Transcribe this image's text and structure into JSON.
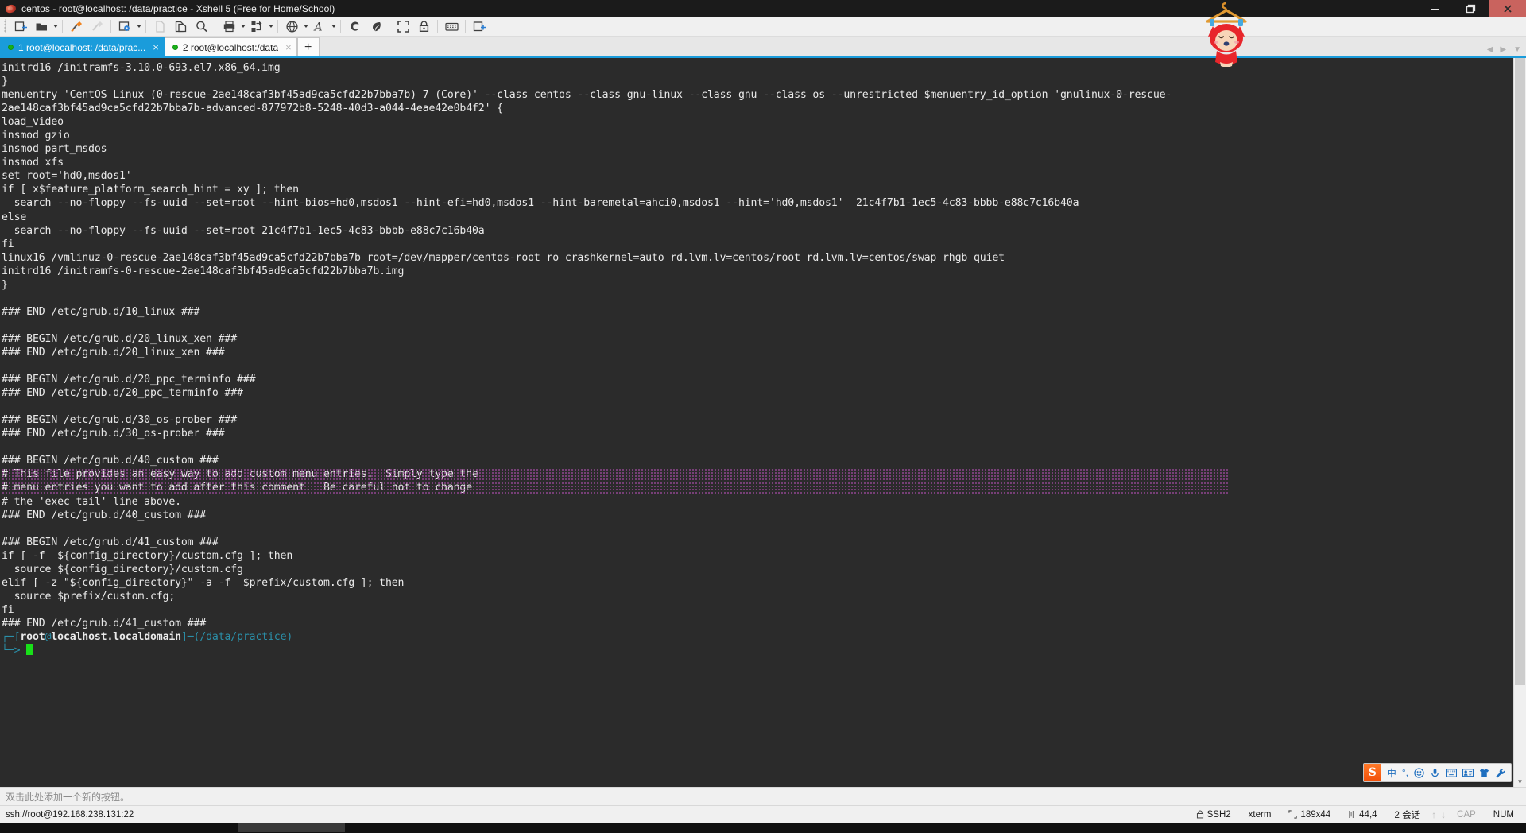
{
  "window": {
    "title": "centos - root@localhost: /data/practice - Xshell 5 (Free for Home/School)",
    "app_icon": "xshell-icon",
    "minimize": "minimize-button",
    "maximize": "maximize-button",
    "close": "close-button"
  },
  "toolbar": {
    "items": [
      {
        "name": "new-session-icon",
        "enabled": true,
        "caret": false
      },
      {
        "name": "open-session-icon",
        "enabled": true,
        "caret": true
      },
      {
        "name": "connect-icon",
        "enabled": true,
        "caret": false
      },
      {
        "name": "disconnect-icon",
        "enabled": false,
        "caret": false
      },
      {
        "name": "session-properties-icon",
        "enabled": true,
        "caret": true
      },
      {
        "name": "copy-icon",
        "enabled": false,
        "caret": false
      },
      {
        "name": "paste-icon",
        "enabled": true,
        "caret": false
      },
      {
        "name": "find-icon",
        "enabled": true,
        "caret": false
      },
      {
        "name": "print-icon",
        "enabled": true,
        "caret": true
      },
      {
        "name": "file-transfer-icon",
        "enabled": true,
        "caret": true
      },
      {
        "name": "globe-icon",
        "enabled": true,
        "caret": true
      },
      {
        "name": "font-icon",
        "enabled": true,
        "caret": true
      },
      {
        "name": "xshell-icon",
        "enabled": true,
        "caret": false
      },
      {
        "name": "xftp-icon",
        "enabled": true,
        "caret": false
      },
      {
        "name": "fullscreen-icon",
        "enabled": true,
        "caret": false
      },
      {
        "name": "lock-icon",
        "enabled": true,
        "caret": false
      },
      {
        "name": "keyboard-icon",
        "enabled": true,
        "caret": false
      },
      {
        "name": "add-button-icon",
        "enabled": true,
        "caret": false
      }
    ]
  },
  "tabs": {
    "items": [
      {
        "label": "1 root@localhost: /data/prac...",
        "active": true,
        "status_color": "#18b018",
        "close": "×"
      },
      {
        "label": "2 root@localhost:/data",
        "active": false,
        "status_color": "#18b018",
        "close": "×"
      }
    ],
    "new_tab_label": "+",
    "nav_prev": "◀",
    "nav_next": "▶",
    "nav_menu": "▼"
  },
  "terminal": {
    "lines": [
      {
        "text": "initrd16 /initramfs-3.10.0-693.el7.x86_64.img"
      },
      {
        "text": "}"
      },
      {
        "text": "menuentry 'CentOS Linux (0-rescue-2ae148caf3bf45ad9ca5cfd22b7bba7b) 7 (Core)' --class centos --class gnu-linux --class gnu --class os --unrestricted $menuentry_id_option 'gnulinux-0-rescue-"
      },
      {
        "text": "2ae148caf3bf45ad9ca5cfd22b7bba7b-advanced-877972b8-5248-40d3-a044-4eae42e0b4f2' {"
      },
      {
        "text": "load_video"
      },
      {
        "text": "insmod gzio"
      },
      {
        "text": "insmod part_msdos"
      },
      {
        "text": "insmod xfs"
      },
      {
        "text": "set root='hd0,msdos1'"
      },
      {
        "text": "if [ x$feature_platform_search_hint = xy ]; then"
      },
      {
        "text": "  search --no-floppy --fs-uuid --set=root --hint-bios=hd0,msdos1 --hint-efi=hd0,msdos1 --hint-baremetal=ahci0,msdos1 --hint='hd0,msdos1'  21c4f7b1-1ec5-4c83-bbbb-e88c7c16b40a"
      },
      {
        "text": "else"
      },
      {
        "text": "  search --no-floppy --fs-uuid --set=root 21c4f7b1-1ec5-4c83-bbbb-e88c7c16b40a"
      },
      {
        "text": "fi"
      },
      {
        "text": "linux16 /vmlinuz-0-rescue-2ae148caf3bf45ad9ca5cfd22b7bba7b root=/dev/mapper/centos-root ro crashkernel=auto rd.lvm.lv=centos/root rd.lvm.lv=centos/swap rhgb quiet"
      },
      {
        "text": "initrd16 /initramfs-0-rescue-2ae148caf3bf45ad9ca5cfd22b7bba7b.img"
      },
      {
        "text": "}"
      },
      {
        "text": ""
      },
      {
        "text": "### END /etc/grub.d/10_linux ###"
      },
      {
        "text": ""
      },
      {
        "text": "### BEGIN /etc/grub.d/20_linux_xen ###"
      },
      {
        "text": "### END /etc/grub.d/20_linux_xen ###"
      },
      {
        "text": ""
      },
      {
        "text": "### BEGIN /etc/grub.d/20_ppc_terminfo ###"
      },
      {
        "text": "### END /etc/grub.d/20_ppc_terminfo ###"
      },
      {
        "text": ""
      },
      {
        "text": "### BEGIN /etc/grub.d/30_os-prober ###"
      },
      {
        "text": "### END /etc/grub.d/30_os-prober ###"
      },
      {
        "text": ""
      },
      {
        "text": "### BEGIN /etc/grub.d/40_custom ###"
      },
      {
        "text": "# This file provides an easy way to add custom menu entries.  Simply type the",
        "highlight": true
      },
      {
        "text": "# menu entries you want to add after this comment.  Be careful not to change",
        "highlight": true
      },
      {
        "text": "# the 'exec tail' line above."
      },
      {
        "text": "### END /etc/grub.d/40_custom ###"
      },
      {
        "text": ""
      },
      {
        "text": "### BEGIN /etc/grub.d/41_custom ###"
      },
      {
        "text": "if [ -f  ${config_directory}/custom.cfg ]; then"
      },
      {
        "text": "  source ${config_directory}/custom.cfg"
      },
      {
        "text": "elif [ -z \"${config_directory}\" -a -f  $prefix/custom.cfg ]; then"
      },
      {
        "text": "  source $prefix/custom.cfg;"
      },
      {
        "text": "fi"
      },
      {
        "text": "### END /etc/grub.d/41_custom ###"
      }
    ],
    "prompt": {
      "top_corner": "┌─",
      "bracket_open": "[",
      "user": "root",
      "at": "@",
      "host": "localhost.localdomain",
      "bracket_close": "]",
      "dash": "─",
      "path_open": "(",
      "path": "/data/practice",
      "path_close": ")",
      "bottom_corner": "└─>"
    }
  },
  "ime": {
    "logo": "S",
    "items": [
      "chinese-mode-icon",
      "punctuation-icon",
      "emoji-icon",
      "voice-input-icon",
      "soft-keyboard-icon",
      "user-card-icon",
      "skin-icon",
      "settings-icon"
    ]
  },
  "button_bar": {
    "hint": "双击此处添加一个新的按钮。"
  },
  "status_bar": {
    "connection": "ssh://root@192.168.238.131:22",
    "protocol": "SSH2",
    "terminal_type": "xterm",
    "size": "189x44",
    "cursor": "44,4",
    "sessions": "2 会话",
    "cap": "CAP",
    "num": "NUM",
    "upload_arrow": "↑",
    "download_arrow": "↓"
  },
  "colors": {
    "accent": "#1a9cdb",
    "terminal_bg": "#2b2b2b",
    "terminal_fg": "#e9e9e9",
    "prompt_cyan": "#2b8fa8",
    "cursor_green": "#19e019",
    "highlight_purple": "#a24ba2",
    "close_red": "#c9635e"
  }
}
